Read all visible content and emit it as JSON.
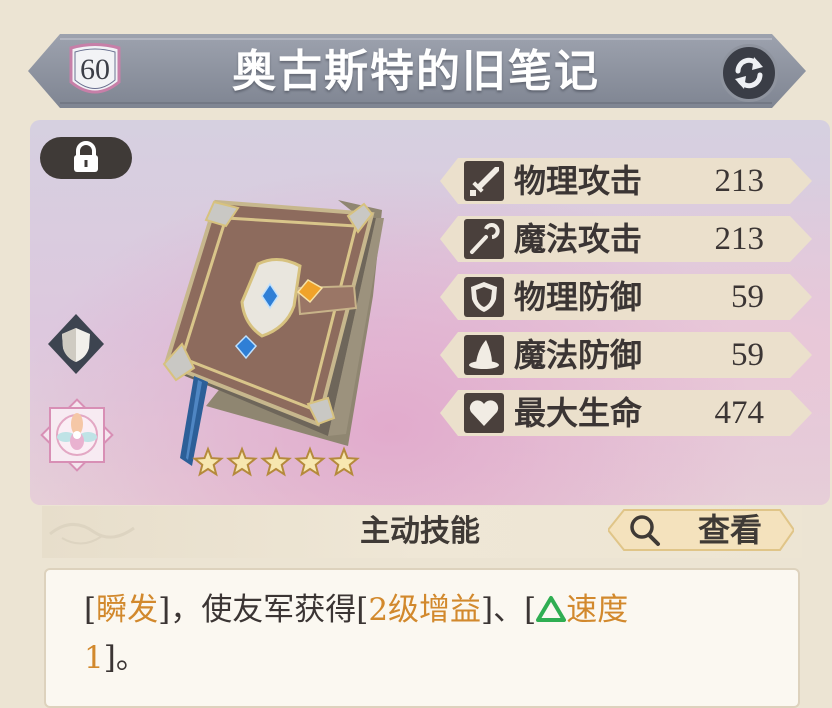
{
  "header": {
    "level": "60",
    "title": "奥古斯特的旧笔记"
  },
  "icons": {
    "swap": "swap-arrows-icon",
    "lock": "padlock-icon",
    "type": "shield-badge-icon",
    "rank": "lotus-emblem-icon",
    "item": "old-notebook-item-icon",
    "search": "magnifier-icon"
  },
  "rarity": {
    "stars": 5
  },
  "stats": [
    {
      "icon": "sword-icon",
      "label": "物理攻击",
      "value": "213"
    },
    {
      "icon": "staff-icon",
      "label": "魔法攻击",
      "value": "213"
    },
    {
      "icon": "shield-icon",
      "label": "物理防御",
      "value": "59"
    },
    {
      "icon": "wizard-hat-icon",
      "label": "魔法防御",
      "value": "59"
    },
    {
      "icon": "heart-icon",
      "label": "最大生命",
      "value": "474"
    }
  ],
  "skill": {
    "section_title": "主动技能",
    "view_label": "查看",
    "desc": {
      "p1": "[",
      "h1": "瞬发",
      "p2": "]，使友军获得[",
      "h2": "2级增益",
      "p3": "]、[",
      "h3": "速度",
      "h4": "1",
      "p4": "]。"
    }
  },
  "colors": {
    "banner": "#8a909d",
    "highlight": "#d2892d",
    "speed_icon": "#2fae52",
    "stat_band": "#ebe0cc",
    "stat_icon_bg": "#4a403c"
  }
}
